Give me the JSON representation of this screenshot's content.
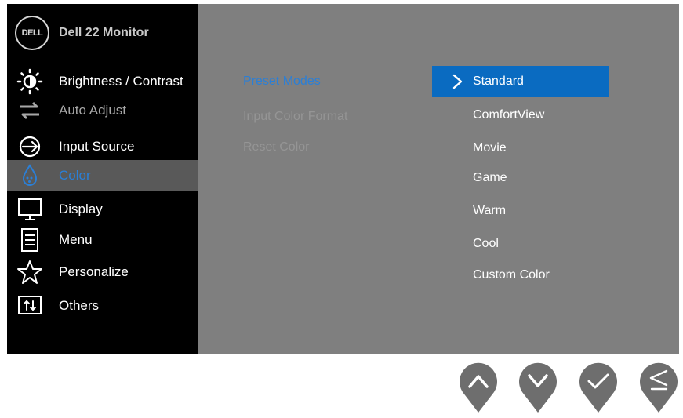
{
  "header": {
    "logo_text": "DELL",
    "title": "Dell 22 Monitor"
  },
  "sidebar": {
    "items": [
      {
        "label": "Brightness / Contrast",
        "icon": "brightness-icon",
        "state": "normal"
      },
      {
        "label": "Auto Adjust",
        "icon": "auto-adjust-icon",
        "state": "disabled"
      },
      {
        "label": "Input Source",
        "icon": "input-source-icon",
        "state": "normal"
      },
      {
        "label": "Color",
        "icon": "color-icon",
        "state": "selected"
      },
      {
        "label": "Display",
        "icon": "display-icon",
        "state": "normal"
      },
      {
        "label": "Menu",
        "icon": "menu-icon",
        "state": "normal"
      },
      {
        "label": "Personalize",
        "icon": "star-icon",
        "state": "normal"
      },
      {
        "label": "Others",
        "icon": "others-icon",
        "state": "normal"
      }
    ]
  },
  "submenu": {
    "items": [
      {
        "label": "Preset Modes",
        "state": "active"
      },
      {
        "label": "Input Color Format",
        "state": "disabled"
      },
      {
        "label": "Reset Color",
        "state": "disabled"
      }
    ]
  },
  "options": {
    "items": [
      {
        "label": "Standard",
        "selected": true
      },
      {
        "label": "ComfortView",
        "selected": false
      },
      {
        "label": "Movie",
        "selected": false
      },
      {
        "label": "Game",
        "selected": false
      },
      {
        "label": "Warm",
        "selected": false
      },
      {
        "label": "Cool",
        "selected": false
      },
      {
        "label": "Custom Color",
        "selected": false
      }
    ]
  },
  "buttons": [
    {
      "icon": "up-arrow-icon"
    },
    {
      "icon": "down-arrow-icon"
    },
    {
      "icon": "checkmark-icon"
    },
    {
      "icon": "back-icon"
    }
  ],
  "colors": {
    "accent": "#2b7fd6",
    "highlight": "#0a6bc1",
    "panel": "#7f7f7f",
    "sidebar": "#000000",
    "button": "#6e6e6e"
  }
}
